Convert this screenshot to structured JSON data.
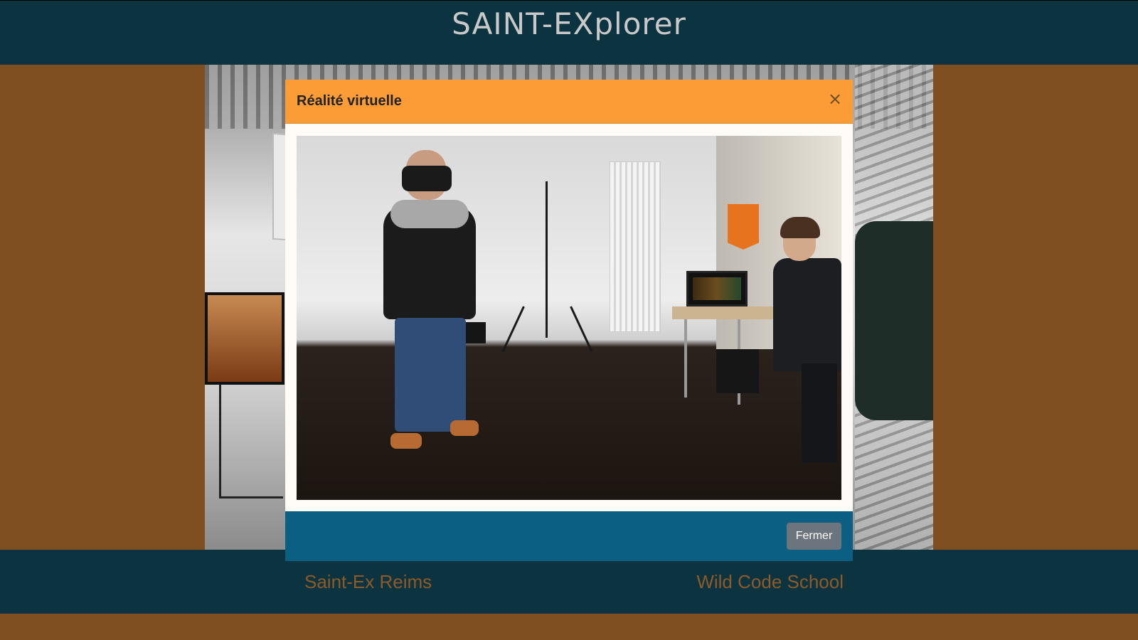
{
  "header": {
    "title": "SAINT-EXplorer"
  },
  "modal": {
    "title": "Réalité virtuelle",
    "close_symbol": "×",
    "close_button_label": "Fermer",
    "header_color": "#fb9c37",
    "footer_color": "#0b5f82"
  },
  "footer": {
    "left_link": "Saint-Ex Reims",
    "right_link": "Wild Code School"
  },
  "colors": {
    "page_background": "#7f4f1f",
    "nav_background": "#0b3340",
    "link_color": "#8f5a27"
  }
}
